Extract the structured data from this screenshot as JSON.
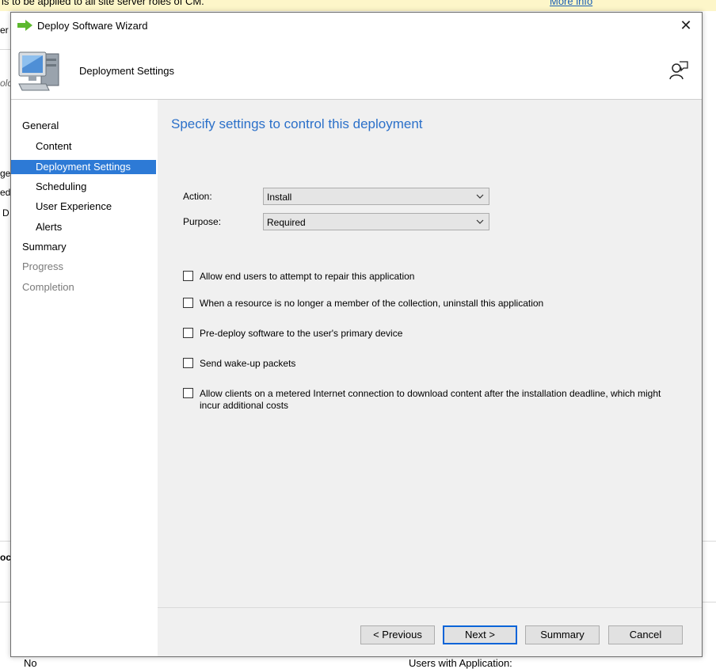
{
  "background": {
    "banner_text": "is to be applied to all site server roles of CM.",
    "banner_link": "More info",
    "left_fragments": [
      "er",
      "olc",
      "ge",
      "ed",
      "D",
      "oc"
    ],
    "footer_left": "No",
    "footer_right": "Users with Application:"
  },
  "wizard": {
    "title": "Deploy Software Wizard",
    "close_glyph": "✕",
    "header_title": "Deployment Settings",
    "nav": [
      {
        "label": "General",
        "state": "normal"
      },
      {
        "label": "Content",
        "state": "normal"
      },
      {
        "label": "Deployment Settings",
        "state": "selected"
      },
      {
        "label": "Scheduling",
        "state": "normal"
      },
      {
        "label": "User Experience",
        "state": "normal"
      },
      {
        "label": "Alerts",
        "state": "normal"
      },
      {
        "label": "Summary",
        "state": "normal"
      },
      {
        "label": "Progress",
        "state": "disabled"
      },
      {
        "label": "Completion",
        "state": "disabled"
      }
    ],
    "page_heading": "Specify settings to control this deployment",
    "action": {
      "label": "Action:",
      "value": "Install"
    },
    "purpose": {
      "label": "Purpose:",
      "value": "Required"
    },
    "options": [
      {
        "label": "Allow end users to attempt to repair this application",
        "checked": false
      },
      {
        "label": "When a resource is no longer a member of the collection, uninstall this application",
        "checked": false
      },
      {
        "label": "Pre-deploy software to the user's primary device",
        "checked": false
      },
      {
        "label": "Send wake-up packets",
        "checked": false
      },
      {
        "label": "Allow clients on a metered Internet connection to download content after the installation deadline, which might incur additional costs",
        "checked": false
      }
    ],
    "buttons": {
      "previous": "< Previous",
      "next": "Next >",
      "summary": "Summary",
      "cancel": "Cancel"
    }
  },
  "colors": {
    "accent": "#2d7ad6",
    "heading": "#2b70c9",
    "content_bg": "#f0f0f0"
  }
}
